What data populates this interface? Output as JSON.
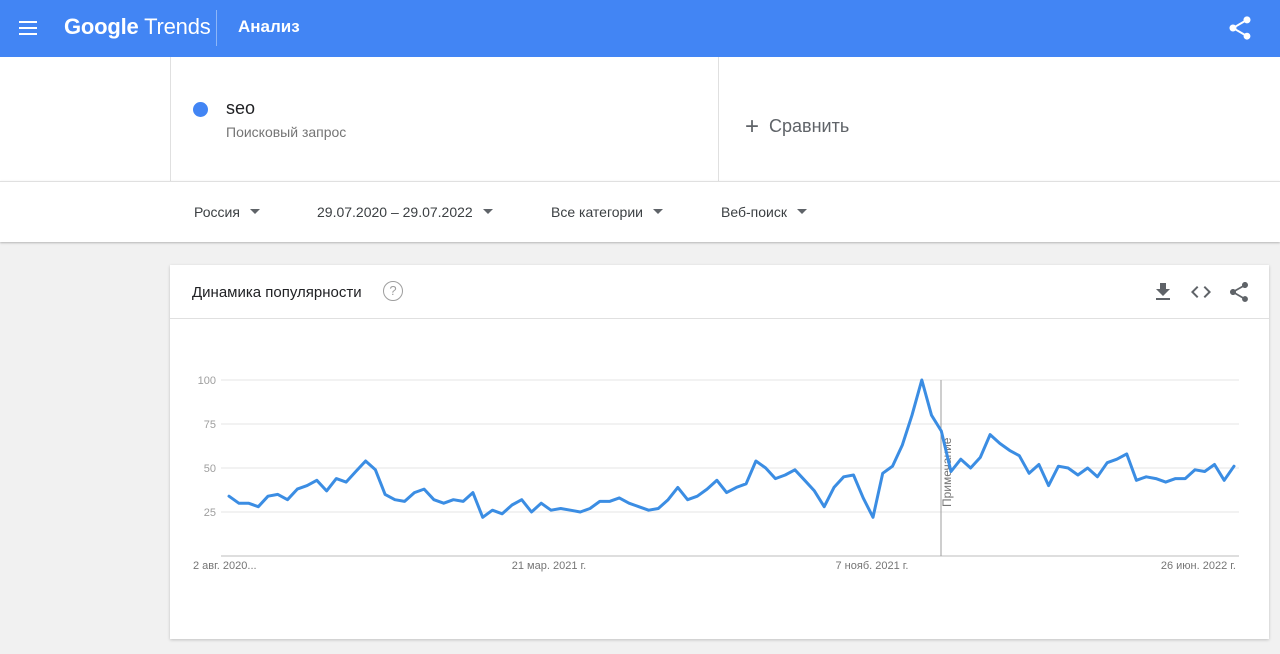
{
  "app": {
    "logo_google": "Google",
    "logo_trends": "Trends",
    "section_title": "Анализ",
    "icons": {
      "menu": "hamburger-menu-icon",
      "share": "share-icon"
    },
    "colors": {
      "brand": "#4285f4",
      "series": "#4285f4",
      "chart_line": "#3b8de3"
    }
  },
  "term": {
    "name": "seo",
    "type": "Поисковый запрос",
    "compare_label": "Сравнить"
  },
  "filters": {
    "region": "Россия",
    "period": "29.07.2020 – 29.07.2022",
    "category": "Все категории",
    "search_type": "Веб-поиск"
  },
  "card": {
    "title": "Динамика популярности",
    "help": "?",
    "icons": [
      "download-icon",
      "embed-code-icon",
      "share-icon"
    ]
  },
  "chart_data": {
    "type": "line",
    "title": "Динамика популярности",
    "ylim": [
      0,
      100
    ],
    "yticks": [
      "100",
      "75",
      "50",
      "25"
    ],
    "xtick_labels": [
      "2 авг. 2020...",
      "21 мар. 2021 г.",
      "7 нояб. 2021 г.",
      "26 июн. 2022 г."
    ],
    "annotation": "Примечание",
    "grid": true,
    "series": [
      {
        "values": [
          34,
          30,
          30,
          28,
          34,
          35,
          32,
          38,
          40,
          43,
          37,
          44,
          42,
          48,
          54,
          49,
          35,
          32,
          31,
          36,
          38,
          32,
          30,
          32,
          31,
          36,
          22,
          26,
          24,
          29,
          32,
          25,
          30,
          26,
          27,
          26,
          25,
          27,
          31,
          31,
          33,
          30,
          28,
          26,
          27,
          32,
          39,
          32,
          34,
          38,
          43,
          36,
          39,
          41,
          54,
          50,
          44,
          46,
          49,
          43,
          37,
          28,
          39,
          45,
          46,
          33,
          22,
          47,
          51,
          63,
          80,
          100,
          80,
          71,
          48,
          55,
          50,
          56,
          69,
          64,
          60,
          57,
          47,
          52,
          40,
          51,
          50,
          46,
          50,
          45,
          53,
          55,
          58,
          43,
          45,
          44,
          42,
          44,
          44,
          49,
          48,
          52,
          43,
          51
        ]
      }
    ]
  }
}
